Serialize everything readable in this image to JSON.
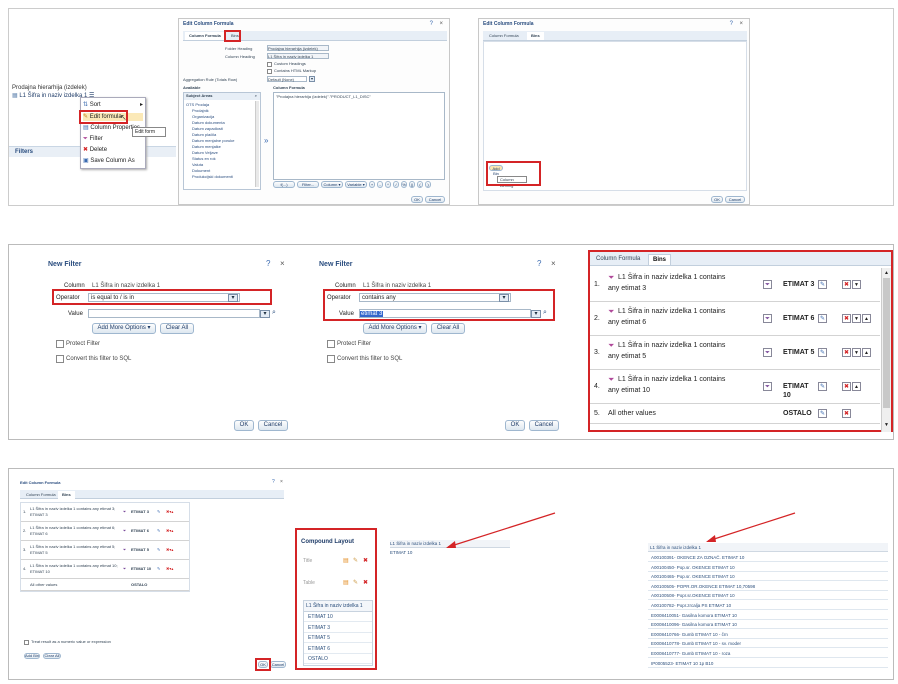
{
  "top": {
    "criteria": {
      "hierarchy_label": "Prodajna hierarhija (izdelek)",
      "column_label": "L1 Šifra in naziv izdelka 1",
      "filters_label": "Filters",
      "menu": [
        "Sort",
        "Edit formula",
        "Column Properties",
        "Filter",
        "Delete",
        "Save Column As"
      ],
      "tooltip": "Edit form"
    },
    "edit_formula": {
      "title": "Edit Column Formula",
      "tab1": "Column Formula",
      "tab2": "Bins",
      "folder_heading_label": "Folder Heading",
      "folder_heading_value": "Prodajna hierarhija (izdelek)",
      "column_heading_label": "Column Heading",
      "column_heading_value": "L1 Šifra in naziv izdelka 1",
      "custom_headings": "Custom Headings",
      "contains_html": "Contains HTML Markup",
      "aggregation_label": "Aggregation Rule (Totals Row)",
      "aggregation_value": "Default (None)",
      "available_label": "Available",
      "subject_areas": "Subject Areas",
      "column_formula_label": "Column Formula",
      "formula": "\"Prodajna hierarhija (izdelek)\".\"PRODUCT_L1_DISC\"",
      "tree": [
        "OTS Prodaja",
        "Prodajnik",
        "Organizacija",
        "Datum dokumenta",
        "Datum zapadlosti",
        "Datum plačila",
        "Datum menjalne poruke",
        "Datum menjalke",
        "Datum Veljave",
        "Status en rok",
        "Valuta",
        "Dokument",
        "Produkcijski dokumenti"
      ],
      "formula_buttons": [
        "f(...)",
        "Filter...",
        "Column ▾",
        "Variable ▾",
        "+",
        "-",
        "*",
        "/",
        "%",
        "||",
        "(",
        ")"
      ],
      "ok": "OK",
      "cancel": "Cancel"
    },
    "edit_bins": {
      "title": "Edit Column Formula",
      "tab1": "Column Formula",
      "tab2": "Bins",
      "add_bin": "Add Bin",
      "tooltip": "Column Binning",
      "ok": "OK",
      "cancel": "Cancel"
    }
  },
  "middle": {
    "filter1": {
      "title": "New Filter",
      "column_label": "Column",
      "column_value": "L1 Šifra in naziv izdelka 1",
      "operator_label": "Operator",
      "operator_value": "is equal to / is in",
      "value_label": "Value",
      "value_value": "",
      "add_more": "Add More Options ▾",
      "clear_all": "Clear All",
      "protect": "Protect Filter",
      "convert": "Convert this filter to SQL",
      "ok": "OK",
      "cancel": "Cancel"
    },
    "filter2": {
      "title": "New Filter",
      "column_label": "Column",
      "column_value": "L1 Šifra in naziv izdelka 1",
      "operator_label": "Operator",
      "operator_value": "contains any",
      "value_label": "Value",
      "value_value": "etimat 3",
      "add_more": "Add More Options ▾",
      "clear_all": "Clear All",
      "protect": "Protect Filter",
      "convert": "Convert this filter to SQL",
      "ok": "OK",
      "cancel": "Cancel"
    },
    "bins": {
      "tab1": "Column Formula",
      "tab2": "Bins",
      "rows": [
        {
          "num": "1.",
          "line1": "L1 Šifra in naziv izdelka 1  contains",
          "line2": "any etimat 3",
          "name": "ETIMAT 3"
        },
        {
          "num": "2.",
          "line1": "L1 Šifra in naziv izdelka 1  contains",
          "line2": "any etimat 6",
          "name": "ETIMAT 6"
        },
        {
          "num": "3.",
          "line1": "L1 Šifra in naziv izdelka 1  contains",
          "line2": "any etimat 5",
          "name": "ETIMAT 5"
        },
        {
          "num": "4.",
          "line1": "L1 Šifra in naziv izdelka 1  contains",
          "line2": "any etimat 10",
          "name": "ETIMAT 10"
        },
        {
          "num": "5.",
          "line1": "All other values",
          "line2": "",
          "name": "OSTALO"
        }
      ]
    }
  },
  "bottom": {
    "bins_small": {
      "title": "Edit Column Formula",
      "tab1": "Column Formula",
      "tab2": "Bins",
      "rows": [
        {
          "num": "1.",
          "text": "L1 Šifra in naziv izdelka 1  contains any etimat 3; ETIMAT 3",
          "name": "ETIMAT 3"
        },
        {
          "num": "2.",
          "text": "L1 Šifra in naziv izdelka 1  contains any etimat 6; ETIMAT 6",
          "name": "ETIMAT 6"
        },
        {
          "num": "3.",
          "text": "L1 Šifra in naziv izdelka 1  contains any etimat 5; ETIMAT 5",
          "name": "ETIMAT 5"
        },
        {
          "num": "4.",
          "text": "L1 Šifra in naziv izdelka 1  contains any etimat 10; ETIMAT 10",
          "name": "ETIMAT 10"
        }
      ],
      "last_row": "All other values",
      "last_name": "OSTALO",
      "treat_numeric": "Treat result as a numeric value or expression",
      "add_bin": "Add Bin",
      "clear_all": "Clear All",
      "ok": "OK",
      "cancel": "Cancel"
    },
    "compound": {
      "title": "Compound Layout",
      "item_title": "Title",
      "item_table": "Table",
      "column_header": "L1 Šifra in naziv izdelka 1",
      "values": [
        "ETIMAT 10",
        "ETIMAT 3",
        "ETIMAT 5",
        "ETIMAT 6",
        "OSTALO"
      ]
    },
    "result_left": {
      "header": "L1 Šifra in naziv izdelka 1",
      "value": "ETIMAT 10"
    },
    "result_right": {
      "header": "L1 Šifra in naziv izdelka 1",
      "rows": [
        "A00100391- OKENCE ZA OZNAČ. ETIMAT 10",
        "A00100450- Pop.sr. OKENCE ETIMAT 10",
        "A00100465- Pop.sr. OKENCE ETIMAT 10",
        "A00100505- POPR.OR.OKENCE ETIMAT 10,70598",
        "A00100508- Popr.sr.OKENCE ETIMAT 10",
        "A00100782- Popr.zrcalja PS ETIMAT 10",
        "E0008410051- Gasilna komora ETIMAT 10",
        "E0008410096- Gasilna komora ETIMAT 10",
        "E0008410766- Gumb ETIMAT 10 - črn",
        "E0008410778- Gumb ETIMAT 10 - sv. moder",
        "E0008410777- Gumb ETIMAT 10 - roza",
        "IP0005523- ETIMAT 10 1p B10"
      ]
    }
  }
}
